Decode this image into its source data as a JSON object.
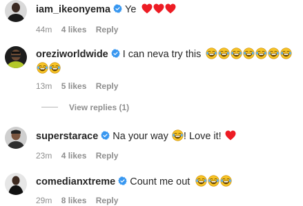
{
  "comments": [
    {
      "username": "iam_ikeonyema",
      "verified": true,
      "text": "Ye",
      "emoji": [
        "heart",
        "heart",
        "heart"
      ],
      "time": "44m",
      "likes": "4 likes",
      "reply": "Reply"
    },
    {
      "username": "oreziworldwide",
      "verified": true,
      "text": "I can neva try this",
      "emoji": [
        "laughing-tears",
        "laughing-tears",
        "laughing-tears",
        "laughing-tears",
        "laughing-tears",
        "laughing-tears",
        "laughing-tears",
        "laughing-tears",
        "laughing-tears"
      ],
      "time": "13m",
      "likes": "5 likes",
      "reply": "Reply",
      "view_replies": "View replies (1)"
    },
    {
      "username": "superstarace",
      "verified": true,
      "text_before": "Na your way",
      "text_after": "! Love it!",
      "emoji": [
        "laughing-tears",
        "heart"
      ],
      "time": "23m",
      "likes": "4 likes",
      "reply": "Reply"
    },
    {
      "username": "comedianxtreme",
      "verified": true,
      "text": "Count me out",
      "emoji": [
        "laughing-tears",
        "laughing-tears",
        "laughing-tears"
      ],
      "time": "29m",
      "likes": "8 likes",
      "reply": "Reply"
    }
  ],
  "colors": {
    "verified": "#3897f0",
    "heart": "#ed1c24",
    "emoji_face": "#f7c325",
    "meta": "#8e8e8e"
  }
}
